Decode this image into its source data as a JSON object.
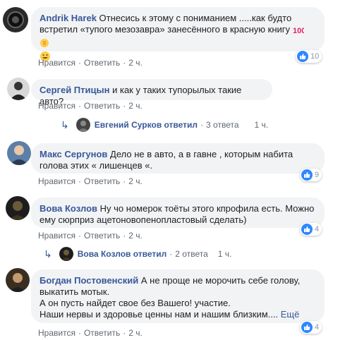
{
  "actions": {
    "like": "Нравится",
    "reply": "Ответить"
  },
  "comments": [
    {
      "author": "Andrik Harek",
      "text": "Отнесись к этому с пониманием .....как будто встретил «тупого мезозавра» занесённого в красную книгу",
      "emojis": [
        "hundred-points-emoji",
        "thumbs-up-emoji",
        "grinning-face-emoji"
      ],
      "time": "2 ч.",
      "reactions": "10"
    },
    {
      "author": "Сергей Птицын",
      "text": "и как у таких тупорылых такие авто?",
      "time": "2 ч.",
      "reply_summary": {
        "name": "Евгений Сурков ответил",
        "count": "3 ответа",
        "time": "1 ч."
      }
    },
    {
      "author": "Макс Сергунов",
      "text": "Дело не в авто, а в гавне , которым набита голова этих « лишенцев «.",
      "time": "2 ч.",
      "reactions": "9"
    },
    {
      "author": "Вова Козлов",
      "text": "Ну чо номерок тоёты этого кпрофила есть. Можно ему сюрприз ацетоновопенопластовый сделать)",
      "time": "2 ч.",
      "reactions": "4",
      "reply_summary": {
        "name": "Вова Козлов ответил",
        "count": "2 ответа",
        "time": "1 ч."
      }
    },
    {
      "author": "Богдан Постовенский",
      "text": "А не проще не морочить себе голову, выкатить мотык.",
      "text2": "А он пусть найдет свое без Вашего! участие.",
      "text3": "Наши нервы и здоровье ценны нам и нашим близким....",
      "more": "Ещё",
      "time": "2 ч.",
      "reactions": "4"
    }
  ],
  "colors": {
    "link": "#385898",
    "like_badge": "#2d88ff",
    "bubble": "#f2f3f5"
  }
}
